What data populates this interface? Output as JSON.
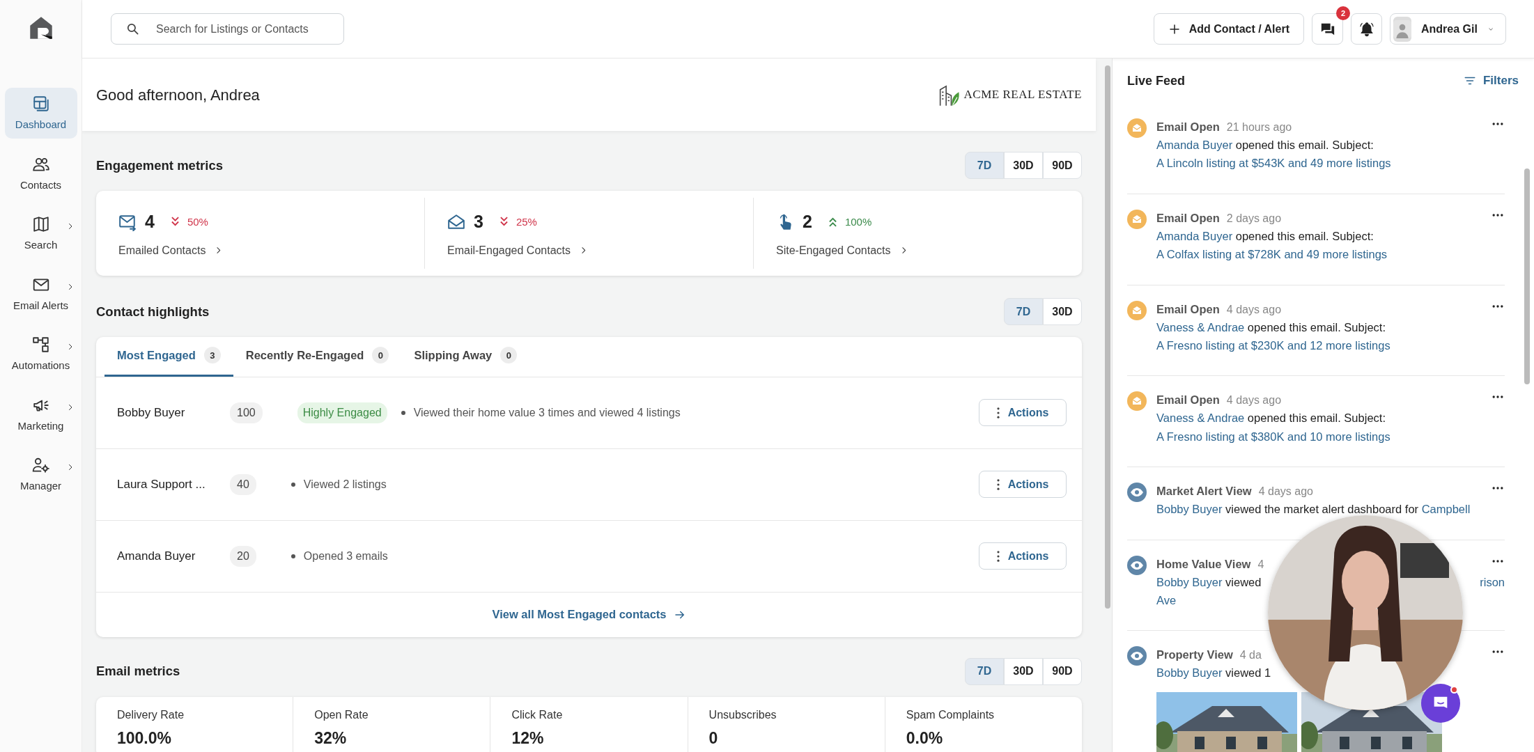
{
  "search": {
    "placeholder": "Search for Listings or Contacts"
  },
  "sidebar": {
    "items": [
      {
        "label": "Dashboard",
        "selected": true,
        "submenu": false
      },
      {
        "label": "Contacts",
        "selected": false,
        "submenu": false
      },
      {
        "label": "Search",
        "selected": false,
        "submenu": true
      },
      {
        "label": "Email Alerts",
        "selected": false,
        "submenu": true
      },
      {
        "label": "Automations",
        "selected": false,
        "submenu": true
      },
      {
        "label": "Marketing",
        "selected": false,
        "submenu": true
      },
      {
        "label": "Manager",
        "selected": false,
        "submenu": true
      }
    ]
  },
  "topbar": {
    "add_button": "Add Contact / Alert",
    "messages_badge": "2",
    "user_name": "Andrea Gil"
  },
  "greeting": {
    "text": "Good afternoon, Andrea",
    "brand_name": "ACME REAL ESTATE"
  },
  "engagement": {
    "title": "Engagement metrics",
    "ranges": [
      {
        "label": "7D",
        "selected": true
      },
      {
        "label": "30D",
        "selected": false
      },
      {
        "label": "90D",
        "selected": false
      }
    ],
    "metrics": [
      {
        "value": "4",
        "change": "50%",
        "rising": false,
        "label": "Emailed Contacts"
      },
      {
        "value": "3",
        "change": "25%",
        "rising": false,
        "label": "Email-Engaged Contacts"
      },
      {
        "value": "2",
        "change": "100%",
        "rising": true,
        "label": "Site-Engaged Contacts"
      }
    ]
  },
  "highlights": {
    "title": "Contact highlights",
    "ranges": [
      {
        "label": "7D",
        "selected": true
      },
      {
        "label": "30D",
        "selected": false
      }
    ],
    "tabs": [
      {
        "label": "Most Engaged",
        "count": "3",
        "selected": true
      },
      {
        "label": "Recently Re-Engaged",
        "count": "0",
        "selected": false
      },
      {
        "label": "Slipping Away",
        "count": "0",
        "selected": false
      }
    ],
    "rows": [
      {
        "name": "Bobby Buyer",
        "score": "100",
        "badge": "Highly Engaged",
        "detail": "Viewed their home value 3 times and viewed 4 listings",
        "action": "Actions"
      },
      {
        "name": "Laura Support ...",
        "score": "40",
        "detail": "Viewed 2 listings",
        "action": "Actions"
      },
      {
        "name": "Amanda Buyer",
        "score": "20",
        "detail": "Opened 3 emails",
        "action": "Actions"
      }
    ],
    "view_all": "View all Most Engaged contacts"
  },
  "email_metrics": {
    "title": "Email metrics",
    "ranges": [
      {
        "label": "7D",
        "selected": true
      },
      {
        "label": "30D",
        "selected": false
      },
      {
        "label": "90D",
        "selected": false
      }
    ],
    "stats": [
      {
        "label": "Delivery Rate",
        "value": "100.0%"
      },
      {
        "label": "Open Rate",
        "value": "32%"
      },
      {
        "label": "Click Rate",
        "value": "12%"
      },
      {
        "label": "Unsubscribes",
        "value": "0"
      },
      {
        "label": "Spam Complaints",
        "value": "0.0%"
      }
    ]
  },
  "feed": {
    "title": "Live Feed",
    "filters": "Filters",
    "items": [
      {
        "kind": "email",
        "title": "Email Open",
        "time": "21 hours ago",
        "lines": [
          {
            "left": [
              {
                "kind": "link",
                "text": "Amanda Buyer"
              },
              {
                "kind": "text",
                "text": " opened this email. Subject:"
              }
            ]
          },
          {
            "left": [
              {
                "kind": "link",
                "text": "A Lincoln listing at $543K and 49 more listings"
              }
            ]
          }
        ]
      },
      {
        "kind": "email",
        "title": "Email Open",
        "time": "2 days ago",
        "lines": [
          {
            "left": [
              {
                "kind": "link",
                "text": "Amanda Buyer"
              },
              {
                "kind": "text",
                "text": " opened this email. Subject:"
              }
            ]
          },
          {
            "left": [
              {
                "kind": "link",
                "text": "A Colfax listing at $728K and 49 more listings"
              }
            ]
          }
        ]
      },
      {
        "kind": "email",
        "title": "Email Open",
        "time": "4 days ago",
        "lines": [
          {
            "left": [
              {
                "kind": "link",
                "text": "Vaness & Andrae"
              },
              {
                "kind": "text",
                "text": " opened this email. Subject:"
              }
            ]
          },
          {
            "left": [
              {
                "kind": "link",
                "text": "A Fresno listing at $230K and 12 more listings"
              }
            ]
          }
        ]
      },
      {
        "kind": "email",
        "title": "Email Open",
        "time": "4 days ago",
        "lines": [
          {
            "left": [
              {
                "kind": "link",
                "text": "Vaness & Andrae"
              },
              {
                "kind": "text",
                "text": " opened this email. Subject:"
              }
            ]
          },
          {
            "left": [
              {
                "kind": "link",
                "text": "A Fresno listing at $380K and 10 more listings"
              }
            ]
          }
        ]
      },
      {
        "kind": "view",
        "title": "Market Alert View",
        "time": "4 days ago",
        "lines": [
          {
            "left": [
              {
                "kind": "link",
                "text": "Bobby Buyer"
              },
              {
                "kind": "text",
                "text": " viewed the market alert dashboard for "
              },
              {
                "kind": "link",
                "text": "Campbell"
              }
            ]
          }
        ]
      },
      {
        "kind": "view",
        "title": "Home Value View",
        "time": "4",
        "lines": [
          {
            "left": [
              {
                "kind": "link",
                "text": "Bobby Buyer"
              },
              {
                "kind": "text",
                "text": " viewed"
              }
            ],
            "right": [
              {
                "kind": "link",
                "text": "rison"
              }
            ]
          },
          {
            "left": [
              {
                "kind": "link",
                "text": "Ave"
              }
            ]
          }
        ]
      },
      {
        "kind": "view",
        "title": "Property View",
        "time": "4 da",
        "lines": [
          {
            "left": [
              {
                "kind": "link",
                "text": "Bobby Buyer"
              },
              {
                "kind": "text",
                "text": " viewed 1"
              }
            ]
          }
        ],
        "photos": [
          {
            "kind": "picture"
          },
          {
            "kind": "picture"
          }
        ]
      }
    ]
  },
  "video": {
    "kind": "picture"
  },
  "chat_launcher": {
    "unread": true
  }
}
